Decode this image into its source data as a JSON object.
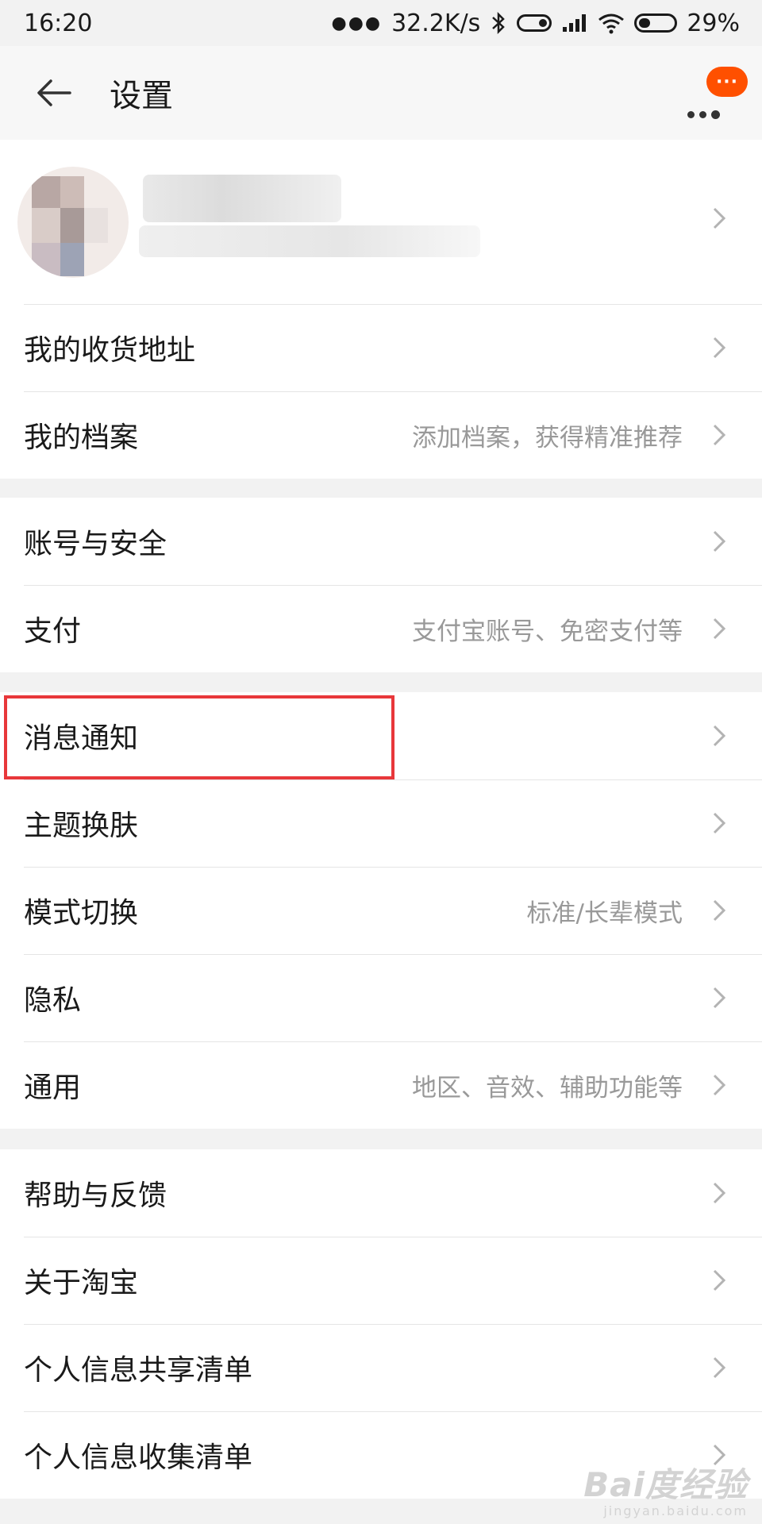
{
  "status_bar": {
    "time": "16:20",
    "speed": "32.2K/s",
    "battery": "29%",
    "icons": [
      "dots-icon",
      "bluetooth-icon",
      "toggle-icon",
      "signal-icon",
      "wifi-icon",
      "battery-icon"
    ]
  },
  "header": {
    "title": "设置",
    "back_icon": "arrow-left-icon",
    "more_icon": "more-dots-icon",
    "badge": "···"
  },
  "groups": [
    {
      "items": [
        {
          "label": "我的收货地址",
          "hint": ""
        },
        {
          "label": "我的档案",
          "hint": "添加档案，获得精准推荐"
        }
      ]
    },
    {
      "items": [
        {
          "label": "账号与安全",
          "hint": ""
        },
        {
          "label": "支付",
          "hint": "支付宝账号、免密支付等"
        }
      ]
    },
    {
      "items": [
        {
          "label": "消息通知",
          "hint": ""
        },
        {
          "label": "主题换肤",
          "hint": ""
        },
        {
          "label": "模式切换",
          "hint": "标准/长辈模式"
        },
        {
          "label": "隐私",
          "hint": ""
        },
        {
          "label": "通用",
          "hint": "地区、音效、辅助功能等"
        }
      ]
    },
    {
      "items": [
        {
          "label": "帮助与反馈",
          "hint": ""
        },
        {
          "label": "关于淘宝",
          "hint": ""
        },
        {
          "label": "个人信息共享清单",
          "hint": ""
        },
        {
          "label": "个人信息收集清单",
          "hint": ""
        }
      ]
    }
  ],
  "watermark": {
    "text": "Bai度经验",
    "sub": "jingyan.baidu.com"
  },
  "colors": {
    "accent": "#ff5000",
    "highlight": "#e8373a",
    "hint": "#999999"
  }
}
